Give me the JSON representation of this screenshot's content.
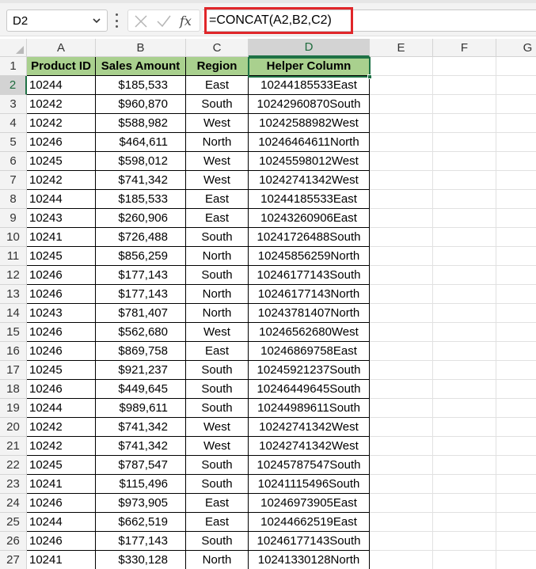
{
  "formula_bar": {
    "name_box": "D2",
    "formula": "=CONCAT(A2,B2,C2)",
    "fx_label": "fx"
  },
  "columns": [
    "A",
    "B",
    "C",
    "D",
    "E",
    "F",
    "G"
  ],
  "headers": [
    "Product ID",
    "Sales Amount",
    "Region",
    "Helper Column"
  ],
  "rows": [
    [
      "10244",
      "$185,533",
      "East",
      "10244185533East"
    ],
    [
      "10242",
      "$960,870",
      "South",
      "10242960870South"
    ],
    [
      "10242",
      "$588,982",
      "West",
      "10242588982West"
    ],
    [
      "10246",
      "$464,611",
      "North",
      "10246464611North"
    ],
    [
      "10245",
      "$598,012",
      "West",
      "10245598012West"
    ],
    [
      "10242",
      "$741,342",
      "West",
      "10242741342West"
    ],
    [
      "10244",
      "$185,533",
      "East",
      "10244185533East"
    ],
    [
      "10243",
      "$260,906",
      "East",
      "10243260906East"
    ],
    [
      "10241",
      "$726,488",
      "South",
      "10241726488South"
    ],
    [
      "10245",
      "$856,259",
      "North",
      "10245856259North"
    ],
    [
      "10246",
      "$177,143",
      "South",
      "10246177143South"
    ],
    [
      "10246",
      "$177,143",
      "North",
      "10246177143North"
    ],
    [
      "10243",
      "$781,407",
      "North",
      "10243781407North"
    ],
    [
      "10246",
      "$562,680",
      "West",
      "10246562680West"
    ],
    [
      "10246",
      "$869,758",
      "East",
      "10246869758East"
    ],
    [
      "10245",
      "$921,237",
      "South",
      "10245921237South"
    ],
    [
      "10246",
      "$449,645",
      "South",
      "10246449645South"
    ],
    [
      "10244",
      "$989,611",
      "South",
      "10244989611South"
    ],
    [
      "10242",
      "$741,342",
      "West",
      "10242741342West"
    ],
    [
      "10242",
      "$741,342",
      "West",
      "10242741342West"
    ],
    [
      "10245",
      "$787,547",
      "South",
      "10245787547South"
    ],
    [
      "10241",
      "$115,496",
      "South",
      "10241115496South"
    ],
    [
      "10246",
      "$973,905",
      "East",
      "10246973905East"
    ],
    [
      "10244",
      "$662,519",
      "East",
      "10244662519East"
    ],
    [
      "10246",
      "$177,143",
      "South",
      "10246177143South"
    ],
    [
      "10241",
      "$330,128",
      "North",
      "10241330128North"
    ]
  ],
  "selected": {
    "column": "D",
    "row": 2
  },
  "colors": {
    "header_fill": "#a9d08e",
    "accent_green": "#1e7145",
    "highlight_red": "#e0262a"
  },
  "icons": {
    "name_box_dropdown": "chevron-down-icon",
    "options": "more-vertical-icon",
    "cancel": "close-icon",
    "enter": "check-icon",
    "function": "fx-icon"
  }
}
